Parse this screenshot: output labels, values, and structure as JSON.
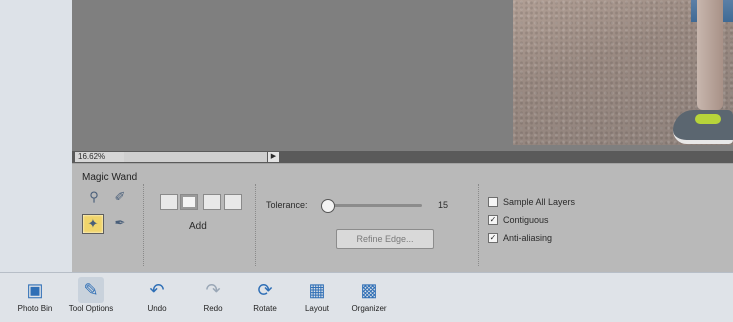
{
  "status": {
    "zoom": "16.62%"
  },
  "options": {
    "tool_name": "Magic Wand",
    "selection_mode_label": "Add",
    "tolerance_label": "Tolerance:",
    "tolerance_value": "15",
    "refine_edge_label": "Refine Edge...",
    "checkboxes": [
      {
        "label": "Sample All Layers",
        "checked": false
      },
      {
        "label": "Contiguous",
        "checked": true
      },
      {
        "label": "Anti-aliasing",
        "checked": true
      }
    ]
  },
  "bottom_bar": {
    "items": [
      {
        "label": "Photo Bin",
        "icon": "photo-bin-icon"
      },
      {
        "label": "Tool Options",
        "icon": "tool-options-icon"
      },
      {
        "label": "Undo",
        "icon": "undo-icon"
      },
      {
        "label": "Redo",
        "icon": "redo-icon"
      },
      {
        "label": "Rotate",
        "icon": "rotate-icon"
      },
      {
        "label": "Layout",
        "icon": "layout-icon"
      },
      {
        "label": "Organizer",
        "icon": "organizer-icon"
      }
    ]
  },
  "colors": {
    "canvas_bg": "#7f7f7f",
    "options_bg": "#b9b9b9",
    "bottom_bar_bg": "#dfe3e8",
    "accent_blue": "#2f6fb6",
    "active_tool": "#f1d56b"
  }
}
